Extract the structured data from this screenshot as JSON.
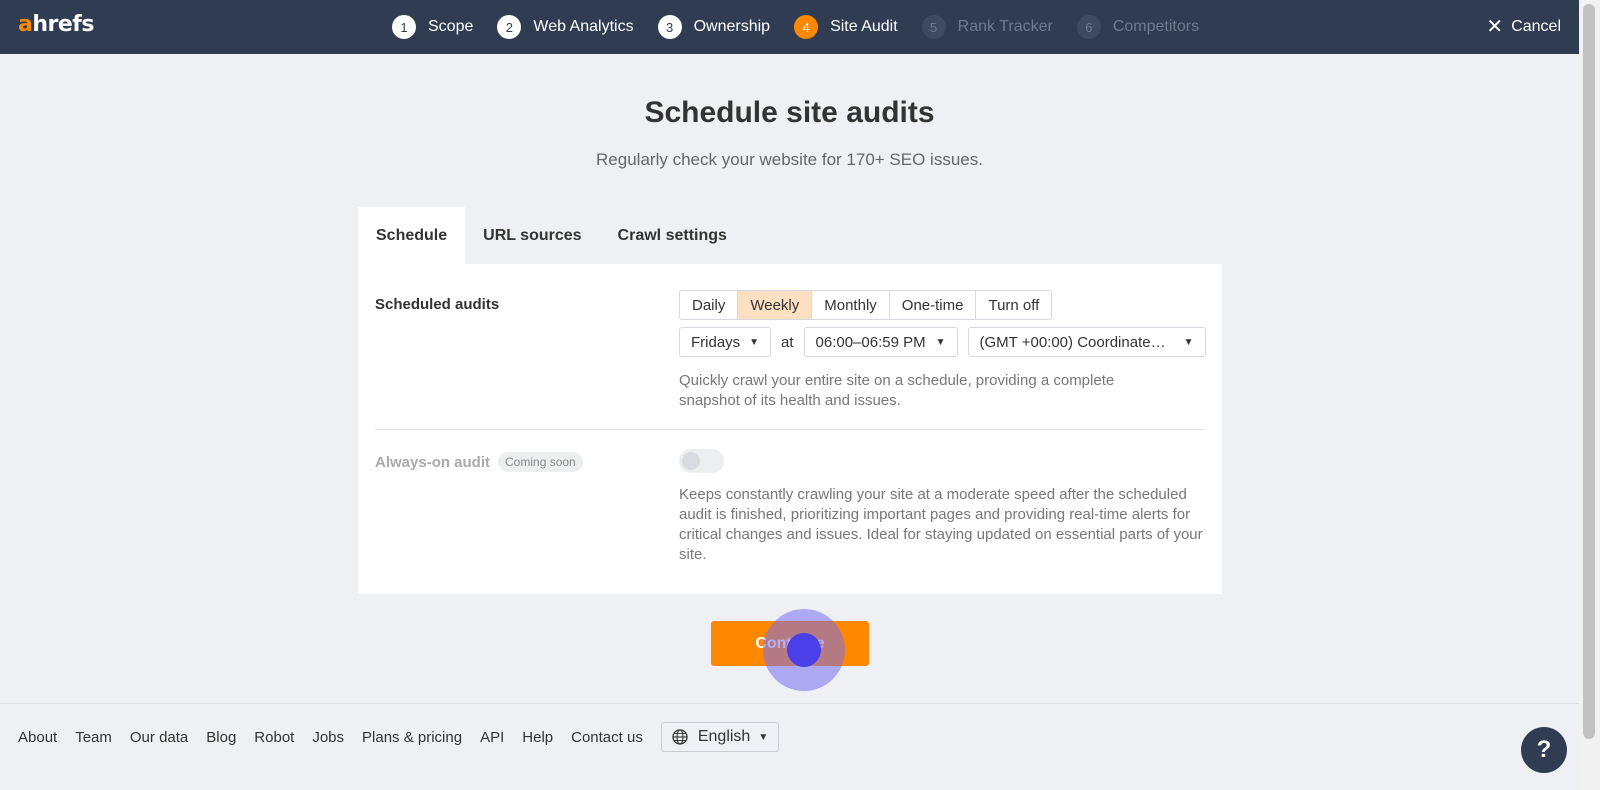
{
  "header": {
    "logo_a": "a",
    "logo_rest": "hrefs",
    "steps": [
      {
        "num": "1",
        "label": "Scope"
      },
      {
        "num": "2",
        "label": "Web Analytics"
      },
      {
        "num": "3",
        "label": "Ownership"
      },
      {
        "num": "4",
        "label": "Site Audit"
      },
      {
        "num": "5",
        "label": "Rank Tracker"
      },
      {
        "num": "6",
        "label": "Competitors"
      }
    ],
    "active_step": 4,
    "cancel_label": "Cancel"
  },
  "main": {
    "title": "Schedule site audits",
    "subtitle": "Regularly check your website for 170+ SEO issues.",
    "tabs": [
      {
        "label": "Schedule"
      },
      {
        "label": "URL sources"
      },
      {
        "label": "Crawl settings"
      }
    ],
    "scheduled": {
      "label": "Scheduled audits",
      "options": [
        "Daily",
        "Weekly",
        "Monthly",
        "One-time",
        "Turn off"
      ],
      "selected": "Weekly",
      "day": "Fridays",
      "at": "at",
      "time": "06:00–06:59 PM",
      "timezone": "(GMT +00:00) Coordinate…",
      "description": "Quickly crawl your entire site on a schedule, providing a complete snapshot of its health and issues."
    },
    "always_on": {
      "label": "Always-on audit",
      "badge": "Coming soon",
      "enabled": false,
      "description": "Keeps constantly crawling your site at a moderate speed after the scheduled audit is finished, prioritizing important pages and providing real-time alerts for critical changes and issues. Ideal for staying updated on essential parts of your site."
    },
    "continue_label": "Continue"
  },
  "footer": {
    "links": [
      "About",
      "Team",
      "Our data",
      "Blog",
      "Robot",
      "Jobs",
      "Plans & pricing",
      "API",
      "Help",
      "Contact us"
    ],
    "language": "English",
    "help_label": "?"
  },
  "colors": {
    "topbar": "#2f3c52",
    "accent": "#ff8800",
    "selected_option": "#fde0c2"
  }
}
